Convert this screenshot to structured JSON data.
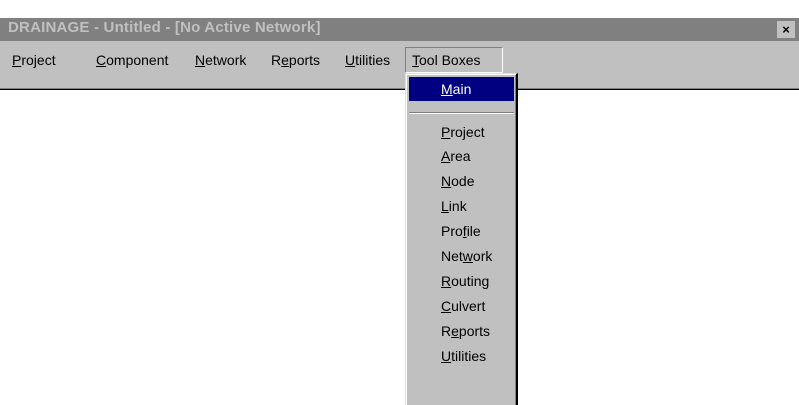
{
  "window": {
    "title": "DRAINAGE - Untitled - [No Active Network]",
    "close_label": "×"
  },
  "menubar": {
    "items": [
      {
        "mnemonic": "P",
        "rest": "roject"
      },
      {
        "mnemonic": "C",
        "rest": "omponent"
      },
      {
        "mnemonic": "N",
        "rest": "etwork"
      },
      {
        "pre": "R",
        "mnemonic": "e",
        "rest": "ports"
      },
      {
        "mnemonic": "U",
        "rest": "tilities"
      },
      {
        "mnemonic": "T",
        "rest": "ool Boxes"
      }
    ]
  },
  "dropdown": {
    "items": [
      {
        "pre": "",
        "mnemonic": "M",
        "rest": "ain"
      },
      {
        "pre": "",
        "mnemonic": "P",
        "rest": "roject"
      },
      {
        "pre": "",
        "mnemonic": "A",
        "rest": "rea"
      },
      {
        "pre": "",
        "mnemonic": "N",
        "rest": "ode"
      },
      {
        "pre": "",
        "mnemonic": "L",
        "rest": "ink"
      },
      {
        "pre": "Pro",
        "mnemonic": "f",
        "rest": "ile"
      },
      {
        "pre": "Net",
        "mnemonic": "w",
        "rest": "ork"
      },
      {
        "pre": "",
        "mnemonic": "R",
        "rest": "outing"
      },
      {
        "pre": "",
        "mnemonic": "C",
        "rest": "ulvert"
      },
      {
        "pre": "R",
        "mnemonic": "e",
        "rest": "ports"
      },
      {
        "pre": "",
        "mnemonic": "U",
        "rest": "tilities"
      }
    ]
  },
  "colors": {
    "titlebar_inactive": "#808080",
    "selection": "#000080",
    "face": "#c0c0c0"
  }
}
